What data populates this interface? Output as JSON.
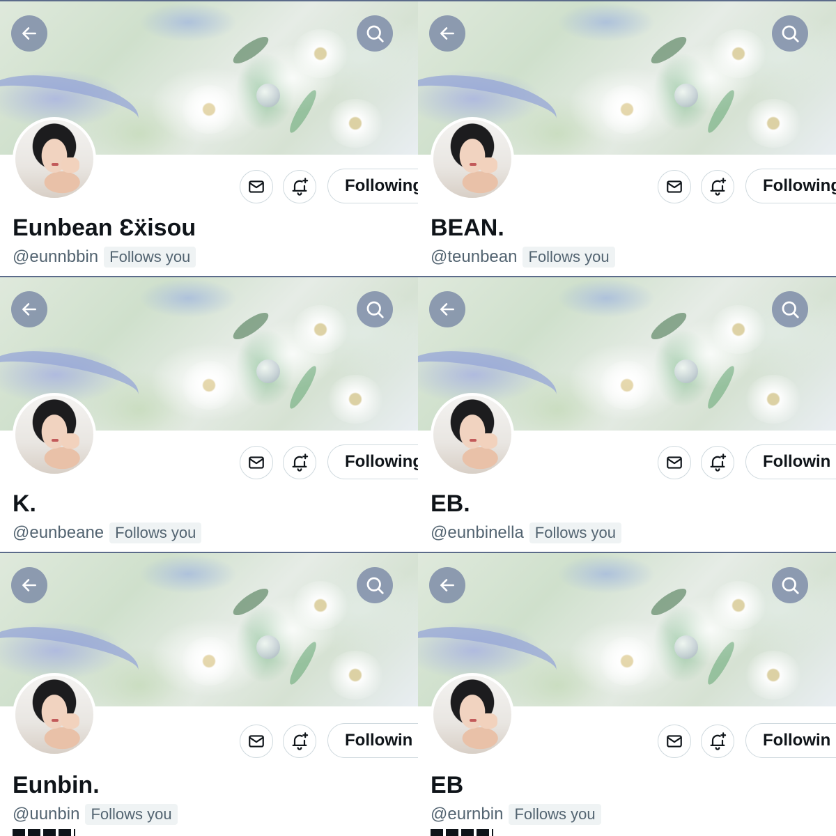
{
  "icons": {
    "back": "arrow-left-icon",
    "search": "search-icon",
    "message": "envelope-icon",
    "notify": "bell-plus-icon"
  },
  "colors": {
    "banner_overlay_button": "#6e7da0",
    "text_primary": "#0f1419",
    "text_secondary": "#536471",
    "badge_background": "#eff3f4"
  },
  "follow_label": "Following",
  "follows_you_label": "Follows you",
  "profiles": [
    {
      "display_name": "Eunbean Ɛẍisou",
      "handle": "@eunnbbin",
      "follow_text": "Following"
    },
    {
      "display_name": "BEAN.",
      "handle": "@teunbean",
      "follow_text": "Following"
    },
    {
      "display_name": "K.",
      "handle": "@eunbeane",
      "follow_text": "Following"
    },
    {
      "display_name": "EB.",
      "handle": "@eunbinella",
      "follow_text": "Followin"
    },
    {
      "display_name": "Eunbin.",
      "handle": "@uunbin",
      "follow_text": "Followin"
    },
    {
      "display_name": "EB",
      "handle": "@eurnbin",
      "follow_text": "Followin"
    }
  ]
}
